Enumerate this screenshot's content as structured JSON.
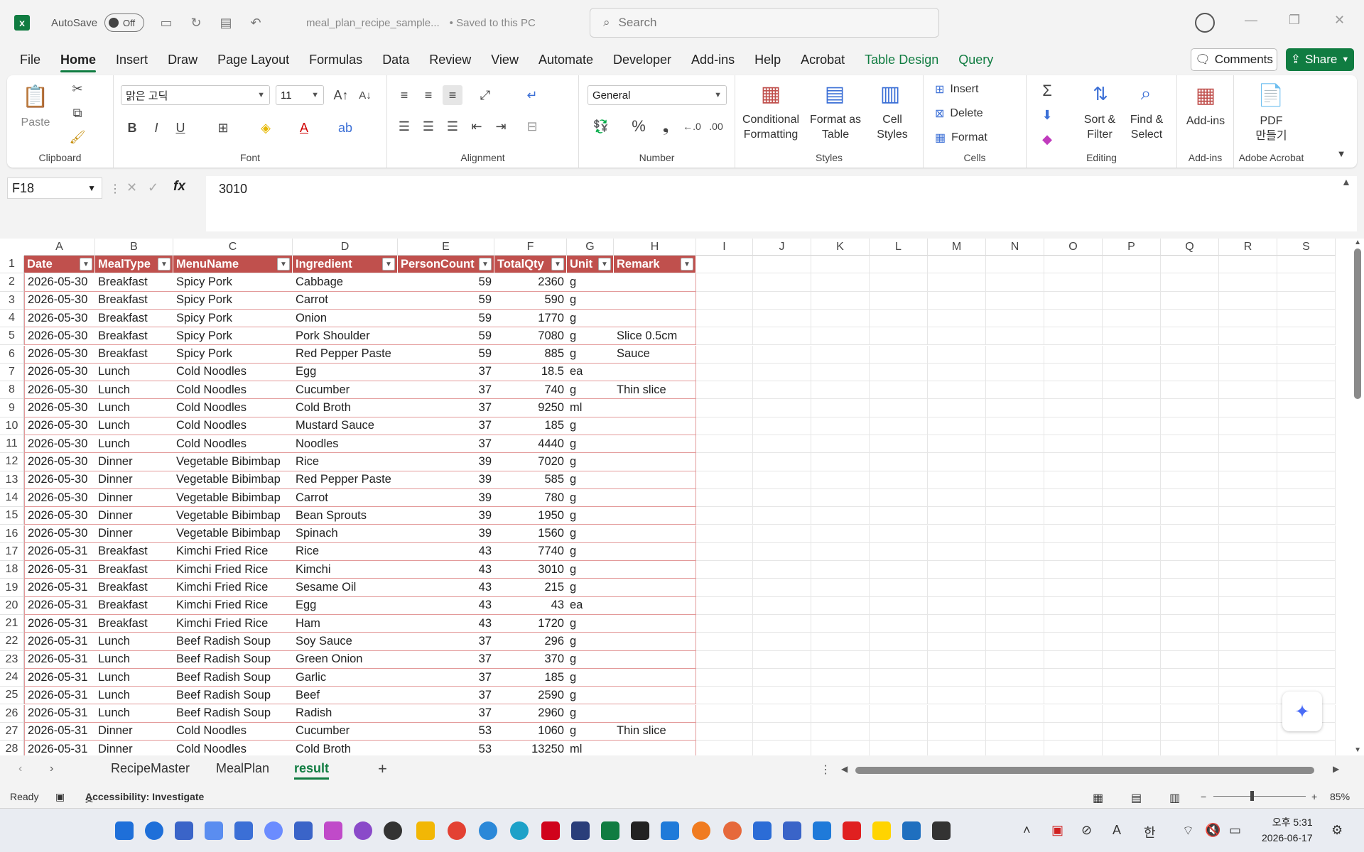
{
  "titlebar": {
    "autosave_label": "AutoSave",
    "autosave_state": "Off",
    "doc_title": "meal_plan_recipe_sample...",
    "saved_status": "• Saved to this PC",
    "search_placeholder": "Search"
  },
  "ribbon_tabs": [
    "File",
    "Home",
    "Insert",
    "Draw",
    "Page Layout",
    "Formulas",
    "Data",
    "Review",
    "View",
    "Automate",
    "Developer",
    "Add-ins",
    "Help",
    "Acrobat",
    "Table Design",
    "Query"
  ],
  "active_tab": "Home",
  "comments_label": "Comments",
  "share_label": "Share",
  "ribbon": {
    "clipboard": {
      "paste": "Paste",
      "label": "Clipboard"
    },
    "font": {
      "name": "맑은 고딕",
      "size": "11",
      "label": "Font"
    },
    "alignment": {
      "label": "Alignment"
    },
    "number": {
      "format": "General",
      "label": "Number"
    },
    "styles": {
      "cond_line1": "Conditional",
      "cond_line2": "Formatting",
      "fmt_line1": "Format as",
      "fmt_line2": "Table",
      "cell_line1": "Cell",
      "cell_line2": "Styles",
      "label": "Styles"
    },
    "cells": {
      "insert": "Insert",
      "delete": "Delete",
      "format": "Format",
      "label": "Cells"
    },
    "editing": {
      "sort_line1": "Sort &",
      "sort_line2": "Filter",
      "find_line1": "Find &",
      "find_line2": "Select",
      "label": "Editing"
    },
    "addins": {
      "btn": "Add-ins",
      "label": "Add-ins"
    },
    "acrobat": {
      "line1": "PDF",
      "line2": "만들기",
      "label": "Adobe Acrobat"
    }
  },
  "formula_bar": {
    "name_box": "F18",
    "fx": "fx",
    "value": "3010"
  },
  "columns": [
    "A",
    "B",
    "C",
    "D",
    "E",
    "F",
    "G",
    "H",
    "I",
    "J",
    "K",
    "L",
    "M",
    "N",
    "O",
    "P",
    "Q",
    "R",
    "S"
  ],
  "table_headers": [
    "Date",
    "MealType",
    "MenuName",
    "Ingredient",
    "PersonCount",
    "TotalQty",
    "Unit",
    "Remark"
  ],
  "rows": [
    [
      "2026-05-30",
      "Breakfast",
      "Spicy Pork",
      "Cabbage",
      "59",
      "2360",
      "g",
      ""
    ],
    [
      "2026-05-30",
      "Breakfast",
      "Spicy Pork",
      "Carrot",
      "59",
      "590",
      "g",
      ""
    ],
    [
      "2026-05-30",
      "Breakfast",
      "Spicy Pork",
      "Onion",
      "59",
      "1770",
      "g",
      ""
    ],
    [
      "2026-05-30",
      "Breakfast",
      "Spicy Pork",
      "Pork Shoulder",
      "59",
      "7080",
      "g",
      "Slice 0.5cm"
    ],
    [
      "2026-05-30",
      "Breakfast",
      "Spicy Pork",
      "Red Pepper Paste",
      "59",
      "885",
      "g",
      "Sauce"
    ],
    [
      "2026-05-30",
      "Lunch",
      "Cold Noodles",
      "Egg",
      "37",
      "18.5",
      "ea",
      ""
    ],
    [
      "2026-05-30",
      "Lunch",
      "Cold Noodles",
      "Cucumber",
      "37",
      "740",
      "g",
      "Thin slice"
    ],
    [
      "2026-05-30",
      "Lunch",
      "Cold Noodles",
      "Cold Broth",
      "37",
      "9250",
      "ml",
      ""
    ],
    [
      "2026-05-30",
      "Lunch",
      "Cold Noodles",
      "Mustard Sauce",
      "37",
      "185",
      "g",
      ""
    ],
    [
      "2026-05-30",
      "Lunch",
      "Cold Noodles",
      "Noodles",
      "37",
      "4440",
      "g",
      ""
    ],
    [
      "2026-05-30",
      "Dinner",
      "Vegetable Bibimbap",
      "Rice",
      "39",
      "7020",
      "g",
      ""
    ],
    [
      "2026-05-30",
      "Dinner",
      "Vegetable Bibimbap",
      "Red Pepper Paste",
      "39",
      "585",
      "g",
      ""
    ],
    [
      "2026-05-30",
      "Dinner",
      "Vegetable Bibimbap",
      "Carrot",
      "39",
      "780",
      "g",
      ""
    ],
    [
      "2026-05-30",
      "Dinner",
      "Vegetable Bibimbap",
      "Bean Sprouts",
      "39",
      "1950",
      "g",
      ""
    ],
    [
      "2026-05-30",
      "Dinner",
      "Vegetable Bibimbap",
      "Spinach",
      "39",
      "1560",
      "g",
      ""
    ],
    [
      "2026-05-31",
      "Breakfast",
      "Kimchi Fried Rice",
      "Rice",
      "43",
      "7740",
      "g",
      ""
    ],
    [
      "2026-05-31",
      "Breakfast",
      "Kimchi Fried Rice",
      "Kimchi",
      "43",
      "3010",
      "g",
      ""
    ],
    [
      "2026-05-31",
      "Breakfast",
      "Kimchi Fried Rice",
      "Sesame Oil",
      "43",
      "215",
      "g",
      ""
    ],
    [
      "2026-05-31",
      "Breakfast",
      "Kimchi Fried Rice",
      "Egg",
      "43",
      "43",
      "ea",
      ""
    ],
    [
      "2026-05-31",
      "Breakfast",
      "Kimchi Fried Rice",
      "Ham",
      "43",
      "1720",
      "g",
      ""
    ],
    [
      "2026-05-31",
      "Lunch",
      "Beef Radish Soup",
      "Soy Sauce",
      "37",
      "296",
      "g",
      ""
    ],
    [
      "2026-05-31",
      "Lunch",
      "Beef Radish Soup",
      "Green Onion",
      "37",
      "370",
      "g",
      ""
    ],
    [
      "2026-05-31",
      "Lunch",
      "Beef Radish Soup",
      "Garlic",
      "37",
      "185",
      "g",
      ""
    ],
    [
      "2026-05-31",
      "Lunch",
      "Beef Radish Soup",
      "Beef",
      "37",
      "2590",
      "g",
      ""
    ],
    [
      "2026-05-31",
      "Lunch",
      "Beef Radish Soup",
      "Radish",
      "37",
      "2960",
      "g",
      ""
    ],
    [
      "2026-05-31",
      "Dinner",
      "Cold Noodles",
      "Cucumber",
      "53",
      "1060",
      "g",
      "Thin slice"
    ],
    [
      "2026-05-31",
      "Dinner",
      "Cold Noodles",
      "Cold Broth",
      "53",
      "13250",
      "ml",
      ""
    ]
  ],
  "sheets": [
    "RecipeMaster",
    "MealPlan",
    "result"
  ],
  "active_sheet": "result",
  "status": {
    "ready": "Ready",
    "accessibility": "Accessibility: Investigate",
    "zoom": "85%"
  },
  "clock": {
    "time": "오후 5:31",
    "date": "2026-06-17"
  },
  "colors": {
    "excel_green": "#107c41",
    "table_header": "#c0504d",
    "table_border": "#e39a9a"
  }
}
